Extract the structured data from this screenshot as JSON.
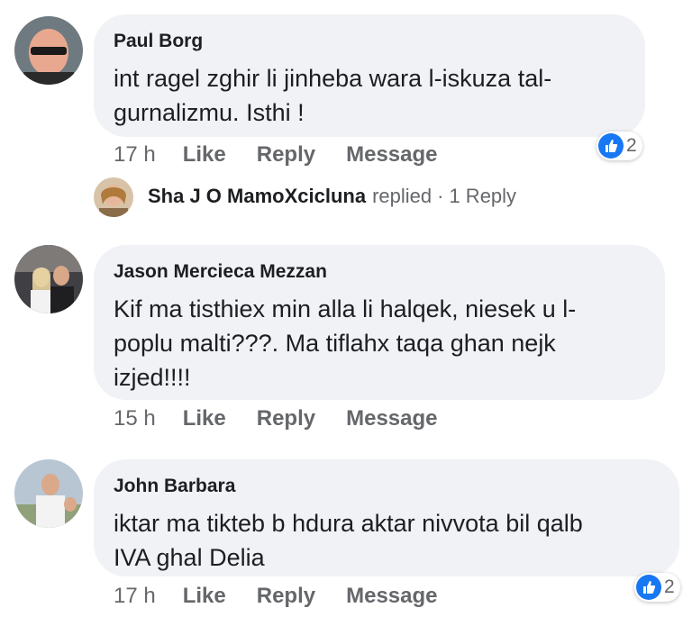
{
  "comments": [
    {
      "author": "Paul Borg",
      "text_lines": [
        "int ragel zghir li jinheba wara l-iskuza tal-",
        "gurnalizmu. Isthi !"
      ],
      "time": "17 h",
      "like": "Like",
      "reply": "Reply",
      "message": "Message",
      "reactions": "2"
    },
    {
      "author": "Jason Mercieca Mezzan",
      "text_lines": [
        "Kif ma tisthiex min alla li halqek, niesek u l-",
        "poplu malti???. Ma tiflahx taqa ghan nejk",
        "izjed!!!!"
      ],
      "time": "15 h",
      "like": "Like",
      "reply": "Reply",
      "message": "Message"
    },
    {
      "author": "John Barbara",
      "text_lines": [
        "iktar ma tikteb b hdura aktar nivvota bil qalb",
        "IVA ghal Delia"
      ],
      "time": "17 h",
      "like": "Like",
      "reply": "Reply",
      "message": "Message",
      "reactions": "2"
    }
  ],
  "reply_preview": {
    "name": "Sha J O MamoXcicluna",
    "suffix": "replied",
    "separator": "·",
    "count": "1 Reply"
  },
  "colors": {
    "bubble": "#f0f2f5",
    "like_blue": "#1877f2",
    "meta_gray": "#65676b"
  }
}
